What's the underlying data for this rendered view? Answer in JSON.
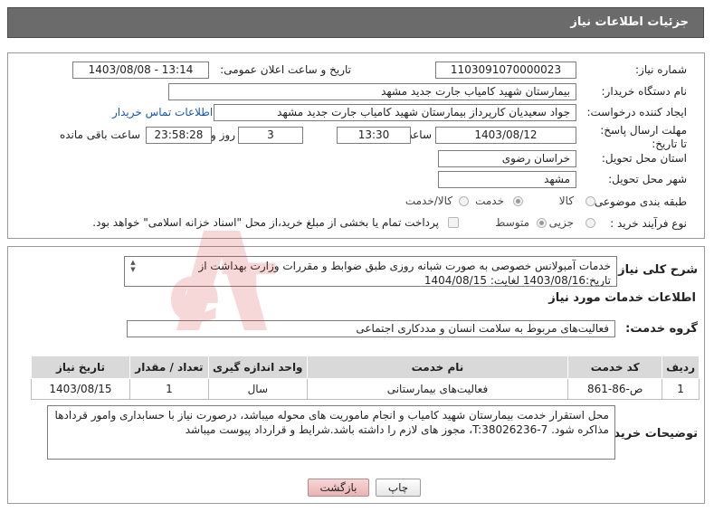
{
  "header": {
    "title": "جزئیات اطلاعات نیاز"
  },
  "form": {
    "need_number_label": "شماره نیاز:",
    "need_number": "1103091070000023",
    "announce_label": "تاریخ و ساعت اعلان عمومی:",
    "announce_value": "1403/08/08 - 13:14",
    "buyer_org_label": "نام دستگاه خریدار:",
    "buyer_org": "بیمارستان شهید کامیاب جارت جدید مشهد",
    "creator_label": "ایجاد کننده درخواست:",
    "creator": "جواد سعیدیان کارپرداز بیمارستان شهید کامیاب جارت جدید مشهد",
    "contact_link": "اطلاعات تماس خریدار",
    "deadline_label": "مهلت ارسال پاسخ: تا تاریخ:",
    "deadline_date": "1403/08/12",
    "time_label": "ساعت",
    "deadline_time": "13:30",
    "days_value": "3",
    "days_label": "روز و",
    "remaining_time": "23:58:28",
    "remaining_label": "ساعت باقی مانده",
    "province_label": "استان محل تحویل:",
    "province": "خراسان رضوی",
    "city_label": "شهر محل تحویل:",
    "city": "مشهد",
    "category_label": "طبقه بندی موضوعی:",
    "category_options": [
      "کالا",
      "خدمت",
      "کالا/خدمت"
    ],
    "process_label": "نوع فرآیند خرید :",
    "process_options": [
      "جزیی",
      "متوسط"
    ],
    "payment_note": "پرداخت تمام یا بخشی از مبلغ خرید،از محل \"اسناد خزانه اسلامی\" خواهد بود."
  },
  "summary": {
    "label": "شرح کلی نیاز:",
    "text": "خدمات آمبولانس خصوصی به صورت شبانه روزی طبق ضوابط  و مقررات وزارت بهداشت از تاریخ:1403/08/16 لغایت: 1404/08/15"
  },
  "services": {
    "section_title": "اطلاعات خدمات مورد نیاز",
    "group_label": "گروه خدمت:",
    "group_value": "فعالیت‌های مربوط به سلامت انسان و مددکاری اجتماعی",
    "columns": [
      "ردیف",
      "کد خدمت",
      "نام خدمت",
      "واحد اندازه گیری",
      "تعداد / مقدار",
      "تاریخ نیاز"
    ],
    "rows": [
      [
        "1",
        "ص-86-861",
        "فعالیت‌های بیمارستانی",
        "سال",
        "1",
        "1403/08/15"
      ]
    ]
  },
  "buyer_notes": {
    "label": "توضیحات خریدار:",
    "text": "محل استقرار خدمت بیمارستان شهید کامیاب و انجام ماموریت های محوله میباشد، درصورت نیاز با حسابداری وامور قردادها مذاکره شود. T:38026236-7، مجوز های لازم را داشته باشد.شرایط و قرارداد پیوست میباشد"
  },
  "buttons": {
    "print": "چاپ",
    "back": "بازگشت"
  },
  "watermark": {
    "text": "AriaTender.neT"
  },
  "colors": {
    "header_bg": "#6b6b6b",
    "link": "#1a56b0",
    "table_header": "#d9d9d9",
    "back_button": "#e9b3b3",
    "watermark": "#d32f2f"
  }
}
